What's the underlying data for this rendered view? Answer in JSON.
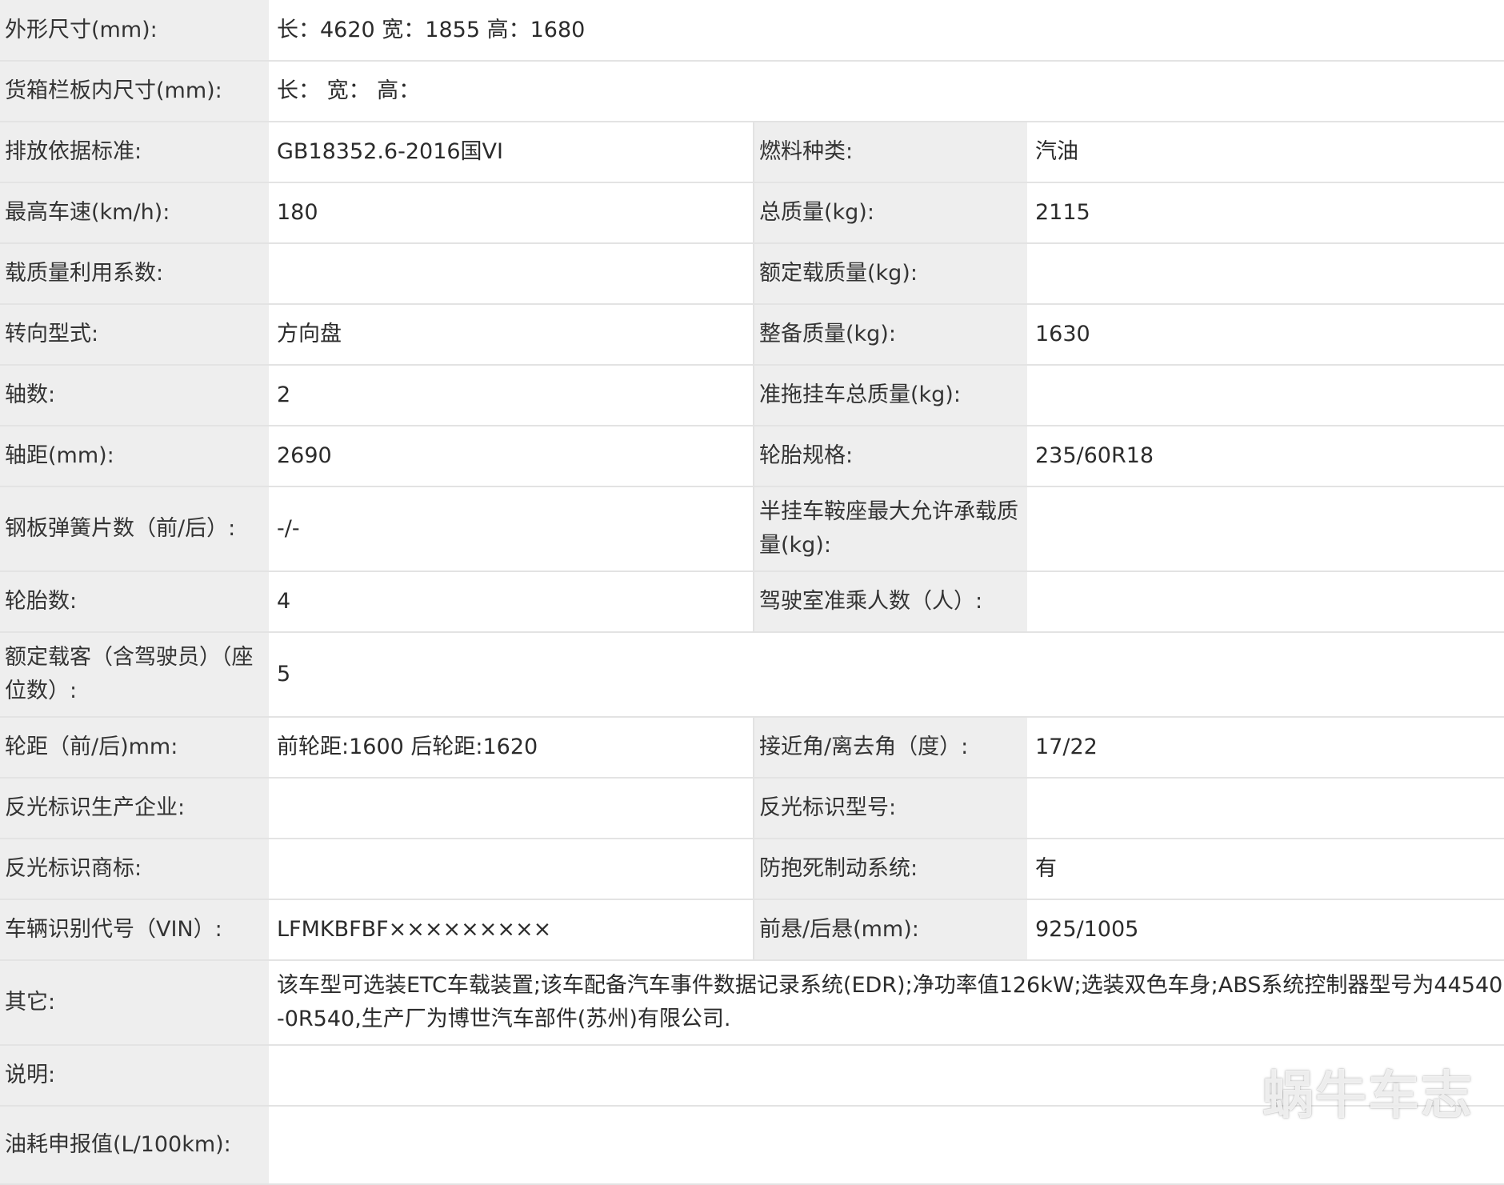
{
  "rows": [
    {
      "label": "外形尺寸(mm):",
      "value": "长：4620 宽：1855 高：1680"
    },
    {
      "label": "货箱栏板内尺寸(mm):",
      "value": "长：  宽：  高："
    },
    {
      "label": "排放依据标准:",
      "value": "GB18352.6-2016国VI",
      "label2": "燃料种类:",
      "value2": "汽油"
    },
    {
      "label": "最高车速(km/h):",
      "value": "180",
      "label2": "总质量(kg):",
      "value2": "2115"
    },
    {
      "label": "载质量利用系数:",
      "value": "",
      "label2": "额定载质量(kg):",
      "value2": ""
    },
    {
      "label": "转向型式:",
      "value": "方向盘",
      "label2": "整备质量(kg):",
      "value2": "1630"
    },
    {
      "label": "轴数:",
      "value": "2",
      "label2": "准拖挂车总质量(kg):",
      "value2": ""
    },
    {
      "label": "轴距(mm):",
      "value": "2690",
      "label2": "轮胎规格:",
      "value2": "235/60R18"
    },
    {
      "label": "钢板弹簧片数（前/后）:",
      "value": "-/-",
      "label2": "半挂车鞍座最大允许承载质量(kg):",
      "value2": ""
    },
    {
      "label": "轮胎数:",
      "value": "4",
      "label2": "驾驶室准乘人数（人）:",
      "value2": ""
    },
    {
      "label": "额定载客（含驾驶员）（座位数）:",
      "value": "5"
    },
    {
      "label": "轮距（前/后)mm:",
      "value": "前轮距:1600 后轮距:1620",
      "label2": "接近角/离去角（度）:",
      "value2": "17/22"
    },
    {
      "label": "反光标识生产企业:",
      "value": "",
      "label2": "反光标识型号:",
      "value2": ""
    },
    {
      "label": "反光标识商标:",
      "value": "",
      "label2": "防抱死制动系统:",
      "value2": "有"
    },
    {
      "label": "车辆识别代号（VIN）:",
      "value": "LFMKBFBF×××××××××",
      "label2": "前悬/后悬(mm):",
      "value2": "925/1005"
    },
    {
      "label": "其它:",
      "value": "该车型可选装ETC车载装置;该车配备汽车事件数据记录系统(EDR);净功率值126kW;选装双色车身;ABS系统控制器型号为44540-0R540,生产厂为博世汽车部件(苏州)有限公司."
    },
    {
      "label": "说明:",
      "value": ""
    },
    {
      "label": "油耗申报值(L/100km):",
      "value": ""
    }
  ],
  "watermark": "蜗牛车志"
}
